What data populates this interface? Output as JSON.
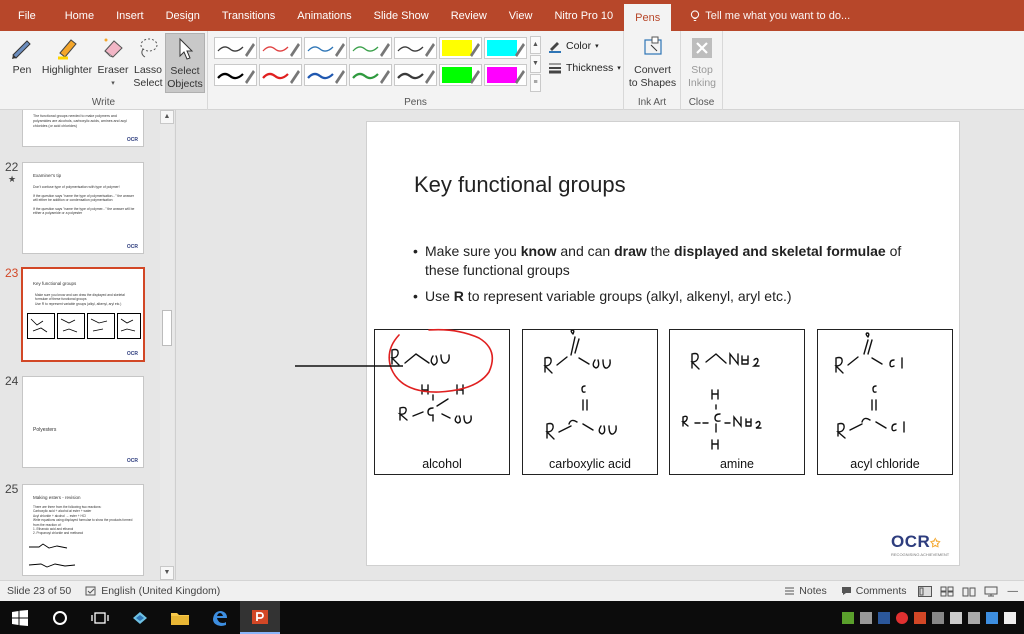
{
  "menu": {
    "items": [
      "File",
      "Home",
      "Insert",
      "Design",
      "Transitions",
      "Animations",
      "Slide Show",
      "Review",
      "View",
      "Nitro Pro 10",
      "Pens"
    ],
    "active": "Pens",
    "tell_me": "Tell me what you want to do..."
  },
  "ribbon": {
    "write": {
      "label": "Write",
      "pen": "Pen",
      "highlighter": "Highlighter",
      "eraser": "Eraser",
      "lasso_line1": "Lasso",
      "lasso_line2": "Select",
      "select_line1": "Select",
      "select_line2": "Objects"
    },
    "pens": {
      "label": "Pens",
      "color": "Color",
      "thickness": "Thickness",
      "row1_colors": [
        "#3a3a3a",
        "#e04040",
        "#2e75b6",
        "#3aa04a",
        "#3a3a3a",
        "#ffff00",
        "#00ffff"
      ],
      "row2_colors": [
        "#000000",
        "#e02020",
        "#2058b0",
        "#2f9a3f",
        "#3a3a3a",
        "#00ff00",
        "#ff00ff"
      ],
      "highlighter_flags": [
        false,
        false,
        false,
        false,
        false,
        true,
        true
      ]
    },
    "ink_art": {
      "label": "Ink Art",
      "convert_line1": "Convert",
      "convert_line2": "to Shapes"
    },
    "close": {
      "label": "Close",
      "stop_line1": "Stop",
      "stop_line2": "Inking"
    }
  },
  "thumbnails": [
    {
      "num": "",
      "title": "",
      "lines": [
        "The functional groups needed to make polymers and",
        "polyamides are alcohols, carboxylic acids, amines and acyl",
        "chlorides (or acid chlorides)"
      ]
    },
    {
      "num": "22",
      "star": "★",
      "title": "Examiner's tip",
      "lines": [
        "Don't confuse type of polymerisation with type of polymer!",
        "If the question says \"name the type of polymerisation...\" the answer will either be addition or condensation polymerisation",
        "If the question says \"name the type of polymer...\" the answer will be either a polyamide or a polyester"
      ]
    },
    {
      "num": "23",
      "title": "Key functional groups",
      "lines": [
        "Make sure you know and can draw the displayed and skeletal formulae of these functional groups",
        "Use R to represent variable groups (alkyl, alkenyl, aryl etc.)"
      ]
    },
    {
      "num": "24",
      "title": "Polyesters",
      "lines": []
    },
    {
      "num": "25",
      "title": "Making esters - revision",
      "lines": [
        "There are three from the following two reactions:",
        "Carboxylic acid + alcohol ⇌ ester + water",
        "Acyl chloride + alcohol → ester + HCl",
        "Write equations using displayed formulae to show the products formed from the reaction of:",
        "1. Ethanoic acid and ethanol",
        "2. Propanoyl chloride and methanol"
      ]
    }
  ],
  "slide": {
    "title": "Key functional groups",
    "bullet1": {
      "pre": "Make sure you ",
      "b1": "know",
      "mid1": " and can ",
      "b2": "draw",
      "mid2": " the ",
      "b3": "displayed and skeletal formulae",
      "post": " of these functional groups"
    },
    "bullet2": {
      "pre": "Use ",
      "b1": "R",
      "post": " to represent variable groups (alkyl, alkenyl, aryl etc.)"
    },
    "boxes": [
      "alcohol",
      "carboxylic acid",
      "amine",
      "acyl chloride"
    ],
    "logo": "OCR",
    "logo_sub": "RECOGNISING ACHIEVEMENT"
  },
  "status": {
    "slide": "Slide 23 of 50",
    "language": "English (United Kingdom)",
    "notes": "Notes",
    "comments": "Comments"
  },
  "colors": {
    "accent": "#b7472a",
    "selected_border": "#d24726",
    "ink_red": "#e02020"
  }
}
